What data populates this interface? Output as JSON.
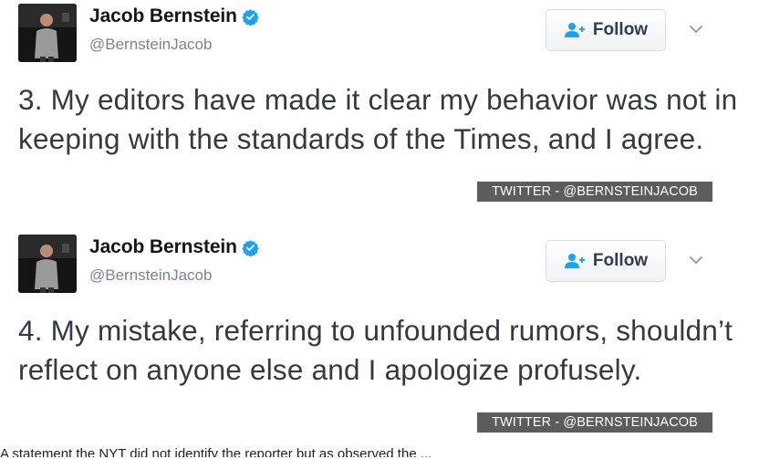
{
  "tweets": [
    {
      "display_name": "Jacob Bernstein",
      "handle": "@BernsteinJacob",
      "follow_label": "Follow",
      "text": "3. My editors have made it clear my behavior was not in keeping with the standards of the Times, and I agree.",
      "credit": "TWITTER - @BERNSTEINJACOB"
    },
    {
      "display_name": "Jacob Bernstein",
      "handle": "@BernsteinJacob",
      "follow_label": "Follow",
      "text": "4. My mistake, referring to unfounded rumors, shouldn’t reflect on anyone else and I apologize profusely.",
      "credit": "TWITTER - @BERNSTEINJACOB"
    }
  ],
  "caption": "A statement the NYT did not identify the reporter but as observed the ...",
  "icons": {
    "verified": "verified-badge-icon",
    "follow": "add-user-icon",
    "more": "chevron-down-icon"
  },
  "colors": {
    "verified_blue": "#1da1f2",
    "follow_icon_blue": "#1da1f2",
    "text": "#333a40",
    "handle": "#7a8490",
    "credit_bg": "#5c5c5c"
  }
}
